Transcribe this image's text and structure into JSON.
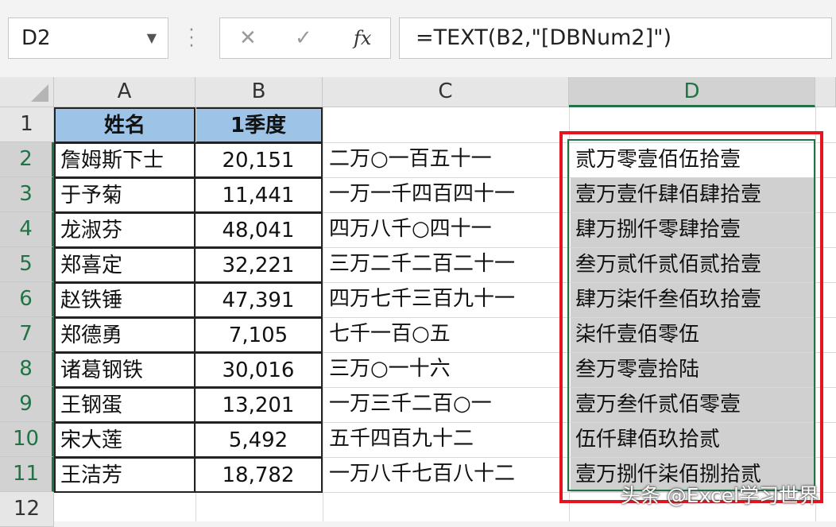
{
  "name_box": "D2",
  "formula": "=TEXT(B2,\"[DBNum2]\")",
  "icons": {
    "cancel": "cancel-icon",
    "enter": "check-icon",
    "fx": "fx-icon"
  },
  "fx_label": "fx",
  "columns": [
    "A",
    "B",
    "C",
    "D"
  ],
  "rows": [
    "1",
    "2",
    "3",
    "4",
    "5",
    "6",
    "7",
    "8",
    "9",
    "10",
    "11",
    "12"
  ],
  "header": {
    "a": "姓名",
    "b": "1季度"
  },
  "table": [
    {
      "name": "詹姆斯下士",
      "q1": "20,151",
      "lower": "二万○一百五十一",
      "upper": "贰万零壹佰伍拾壹"
    },
    {
      "name": "于予菊",
      "q1": "11,441",
      "lower": "一万一千四百四十一",
      "upper": "壹万壹仟肆佰肆拾壹"
    },
    {
      "name": "龙淑芬",
      "q1": "48,041",
      "lower": "四万八千○四十一",
      "upper": "肆万捌仟零肆拾壹"
    },
    {
      "name": "郑喜定",
      "q1": "32,221",
      "lower": "三万二千二百二十一",
      "upper": "叁万贰仟贰佰贰拾壹"
    },
    {
      "name": "赵铁锤",
      "q1": "47,391",
      "lower": "四万七千三百九十一",
      "upper": "肆万柒仟叁佰玖拾壹"
    },
    {
      "name": "郑德勇",
      "q1": "7,105",
      "lower": "七千一百○五",
      "upper": "柒仟壹佰零伍"
    },
    {
      "name": "诸葛钢铁",
      "q1": "30,016",
      "lower": "三万○一十六",
      "upper": "叁万零壹拾陆"
    },
    {
      "name": "王钢蛋",
      "q1": "13,201",
      "lower": "一万三千二百○一",
      "upper": "壹万叁仟贰佰零壹"
    },
    {
      "name": "宋大莲",
      "q1": "5,492",
      "lower": "五千四百九十二",
      "upper": "伍仟肆佰玖拾贰"
    },
    {
      "name": "王洁芳",
      "q1": "18,782",
      "lower": "一万八千七百八十二",
      "upper": "壹万捌仟柒佰捌拾贰"
    }
  ],
  "watermark": "头条 @Excel学习世界",
  "colors": {
    "header_fill": "#9dc3e6",
    "selection": "#217346",
    "highlight": "#e5141f",
    "selected_fill": "#d0d0d0"
  }
}
